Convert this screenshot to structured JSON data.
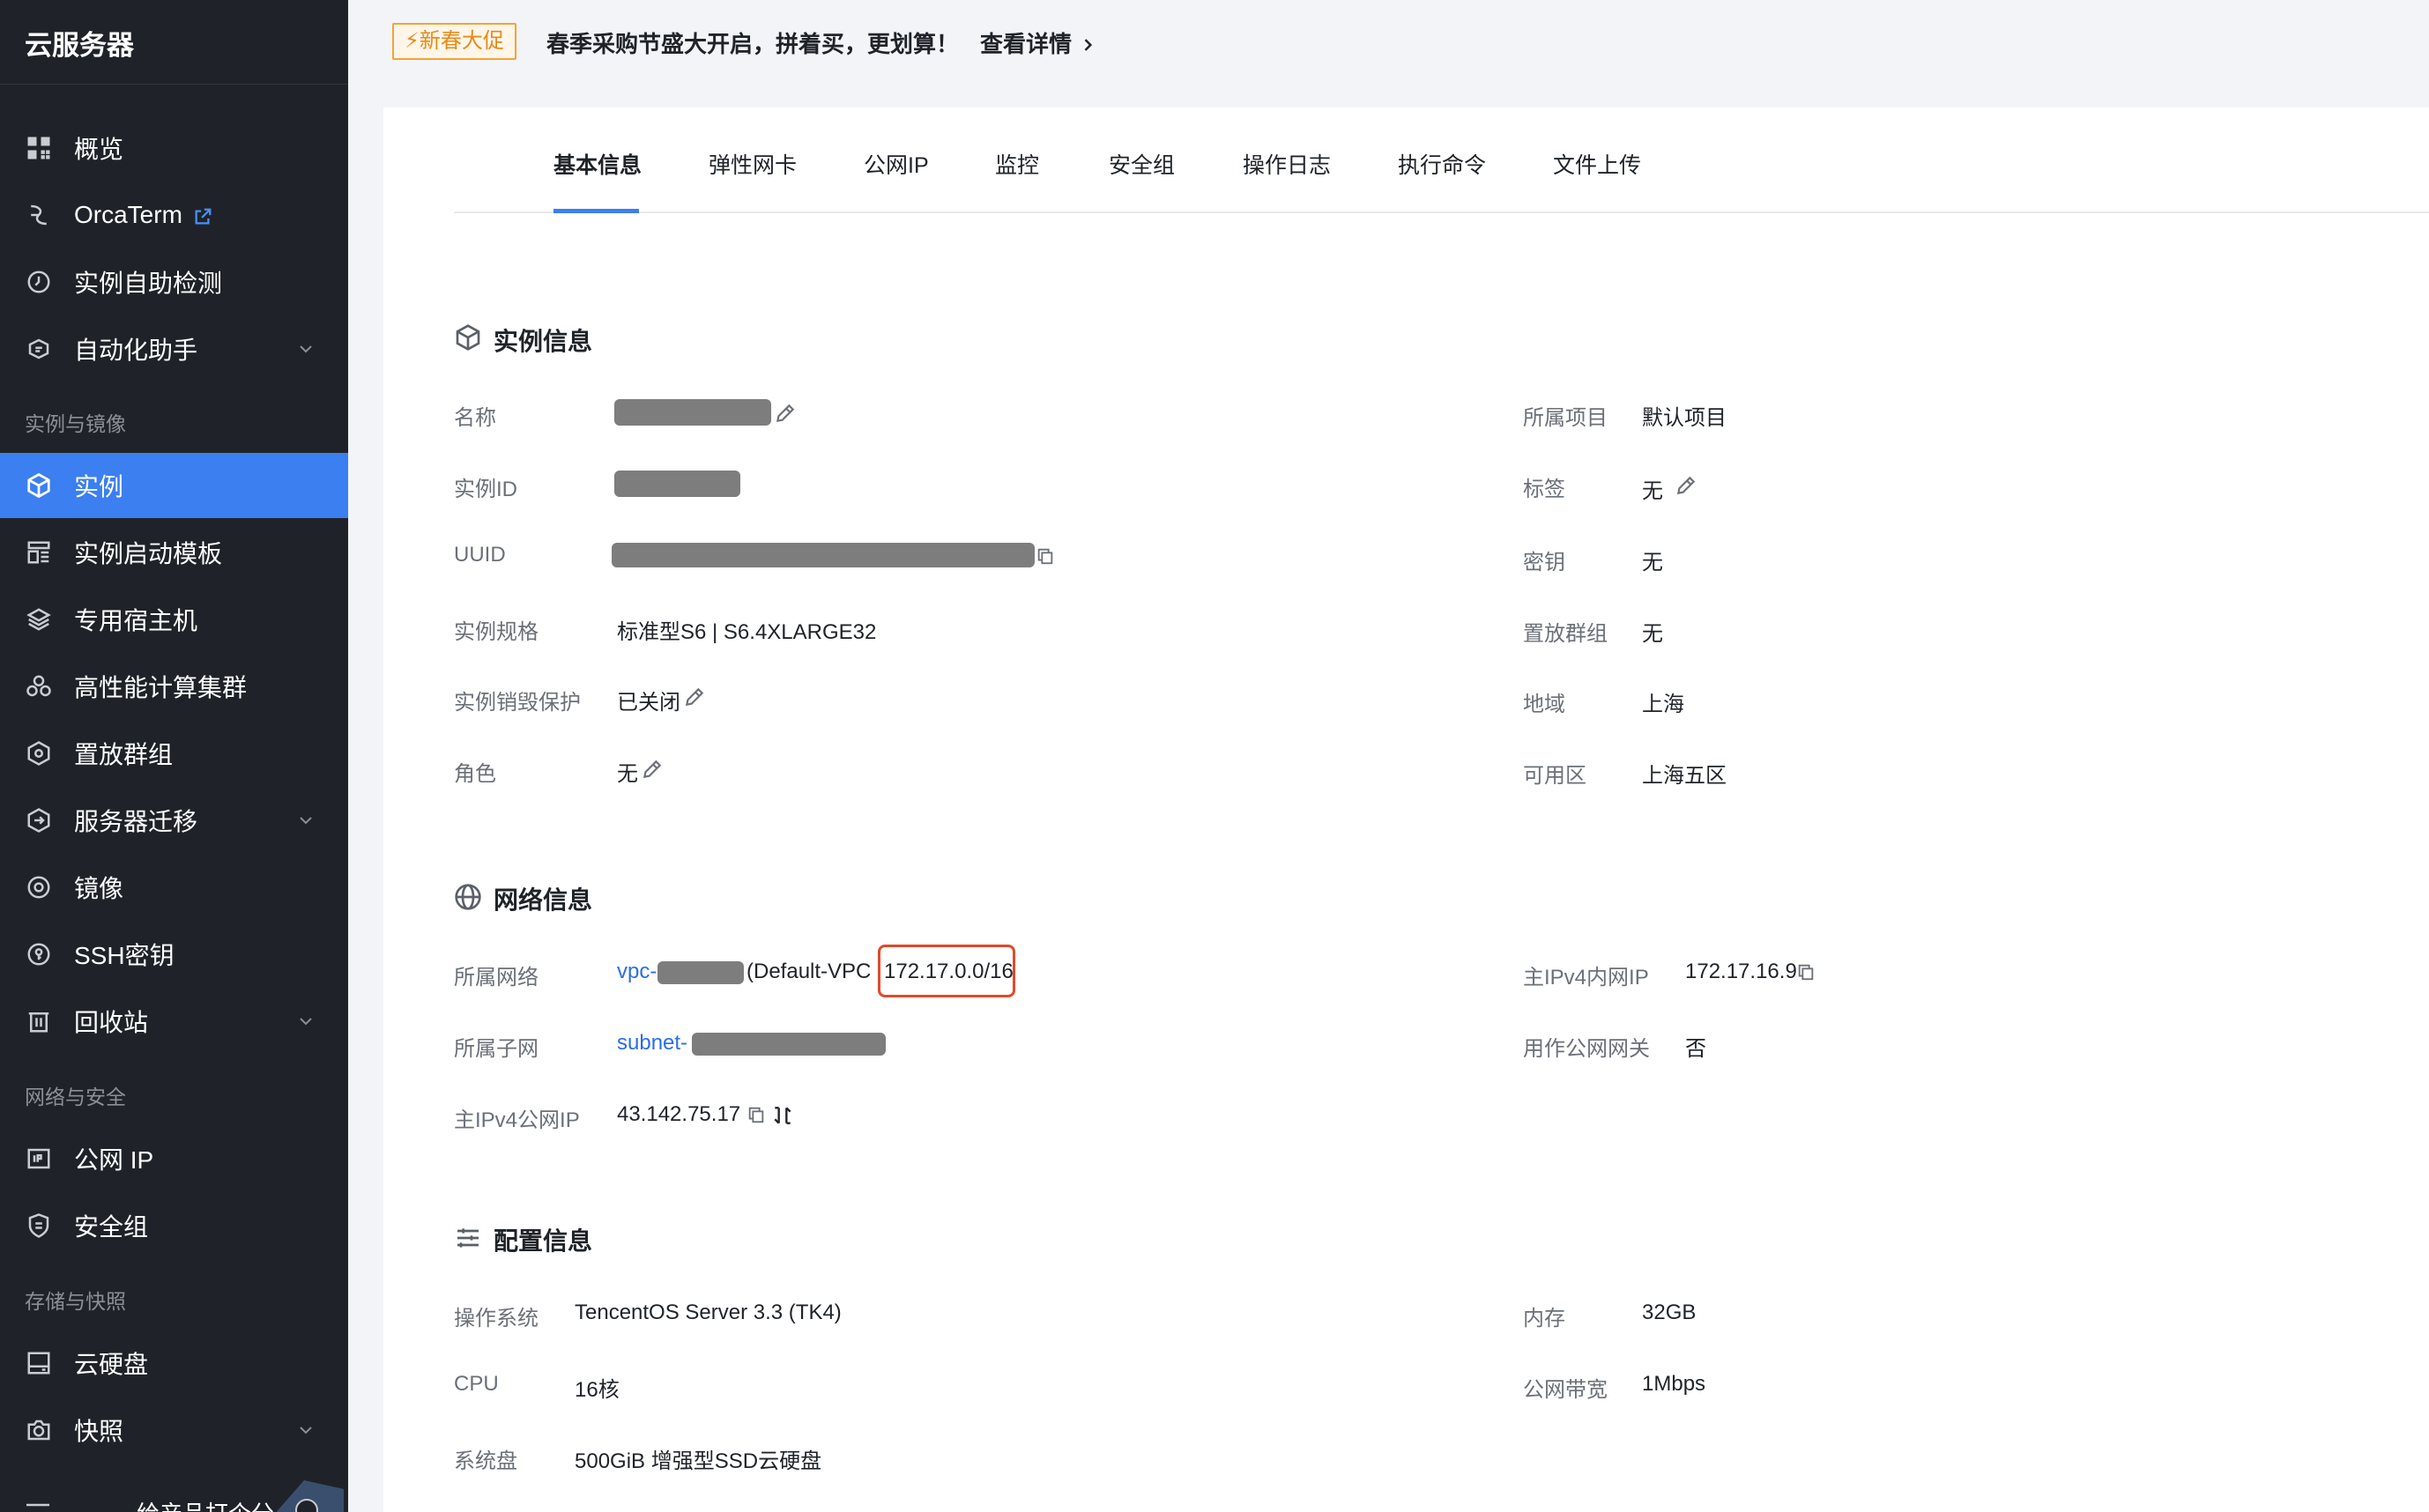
{
  "sidebar": {
    "title": "云服务器",
    "items": [
      {
        "label": "概览",
        "icon": "dashboard-grid-icon"
      },
      {
        "label": "OrcaTerm",
        "icon": "orcaterm-icon",
        "external": true
      },
      {
        "label": "实例自助检测",
        "icon": "self-check-icon"
      },
      {
        "label": "自动化助手",
        "icon": "automation-icon",
        "expandable": true
      }
    ],
    "section_instances": "实例与镜像",
    "instance_items": [
      {
        "label": "实例",
        "icon": "instance-cube-icon",
        "active": true
      },
      {
        "label": "实例启动模板",
        "icon": "template-icon"
      },
      {
        "label": "专用宿主机",
        "icon": "layers-icon"
      },
      {
        "label": "高性能计算集群",
        "icon": "cluster-icon"
      },
      {
        "label": "置放群组",
        "icon": "placement-group-icon"
      },
      {
        "label": "服务器迁移",
        "icon": "migration-icon",
        "expandable": true
      },
      {
        "label": "镜像",
        "icon": "image-disc-icon"
      },
      {
        "label": "SSH密钥",
        "icon": "ssh-key-icon"
      },
      {
        "label": "回收站",
        "icon": "recycle-bin-icon",
        "expandable": true
      }
    ],
    "section_network": "网络与安全",
    "network_items": [
      {
        "label": "公网 IP",
        "icon": "public-ip-icon"
      },
      {
        "label": "安全组",
        "icon": "security-shield-icon"
      }
    ],
    "section_storage": "存储与快照",
    "storage_items": [
      {
        "label": "云硬盘",
        "icon": "disk-icon"
      },
      {
        "label": "快照",
        "icon": "camera-icon",
        "expandable": true
      }
    ],
    "bottom_label": "给产品打个分"
  },
  "banner": {
    "badge": "新春大促",
    "text": "春季采购节盛大开启，拼着买，更划算！",
    "link": "查看详情"
  },
  "tabs": [
    "基本信息",
    "弹性网卡",
    "公网IP",
    "监控",
    "安全组",
    "操作日志",
    "执行命令",
    "文件上传"
  ],
  "instance_info": {
    "title": "实例信息",
    "left": {
      "name_label": "名称",
      "id_label": "实例ID",
      "uuid_label": "UUID",
      "spec_label": "实例规格",
      "spec_value": "标准型S6 | S6.4XLARGE32",
      "protect_label": "实例销毁保护",
      "protect_value": "已关闭",
      "role_label": "角色",
      "role_value": "无"
    },
    "right": {
      "project_label": "所属项目",
      "project_value": "默认项目",
      "tag_label": "标签",
      "tag_value": "无",
      "key_label": "密钥",
      "key_value": "无",
      "placement_label": "置放群组",
      "placement_value": "无",
      "region_label": "地域",
      "region_value": "上海",
      "zone_label": "可用区",
      "zone_value": "上海五区"
    }
  },
  "network_info": {
    "title": "网络信息",
    "vpc_label": "所属网络",
    "vpc_prefix": "vpc-",
    "vpc_name": "(Default-VPC",
    "vpc_cidr": "172.17.0.0/16",
    "subnet_label": "所属子网",
    "subnet_prefix": "subnet-",
    "public_ip_label": "主IPv4公网IP",
    "public_ip_value": "43.142.75.17",
    "private_ip_label": "主IPv4内网IP",
    "private_ip_value": "172.17.16.9",
    "gateway_label": "用作公网网关",
    "gateway_value": "否"
  },
  "config_info": {
    "title": "配置信息",
    "os_label": "操作系统",
    "os_value": "TencentOS Server 3.3 (TK4)",
    "cpu_label": "CPU",
    "cpu_value": "16核",
    "disk_label": "系统盘",
    "disk_value": "500GiB 增强型SSD云硬盘",
    "memory_label": "内存",
    "memory_value": "32GB",
    "bandwidth_label": "公网带宽",
    "bandwidth_value": "1Mbps"
  },
  "colors": {
    "sidebar_bg": "#1f2329",
    "active_blue": "#3b7ff0",
    "link_blue": "#2b6de5",
    "highlight_red": "#e04a2b",
    "promo_orange": "#f2a33a"
  }
}
